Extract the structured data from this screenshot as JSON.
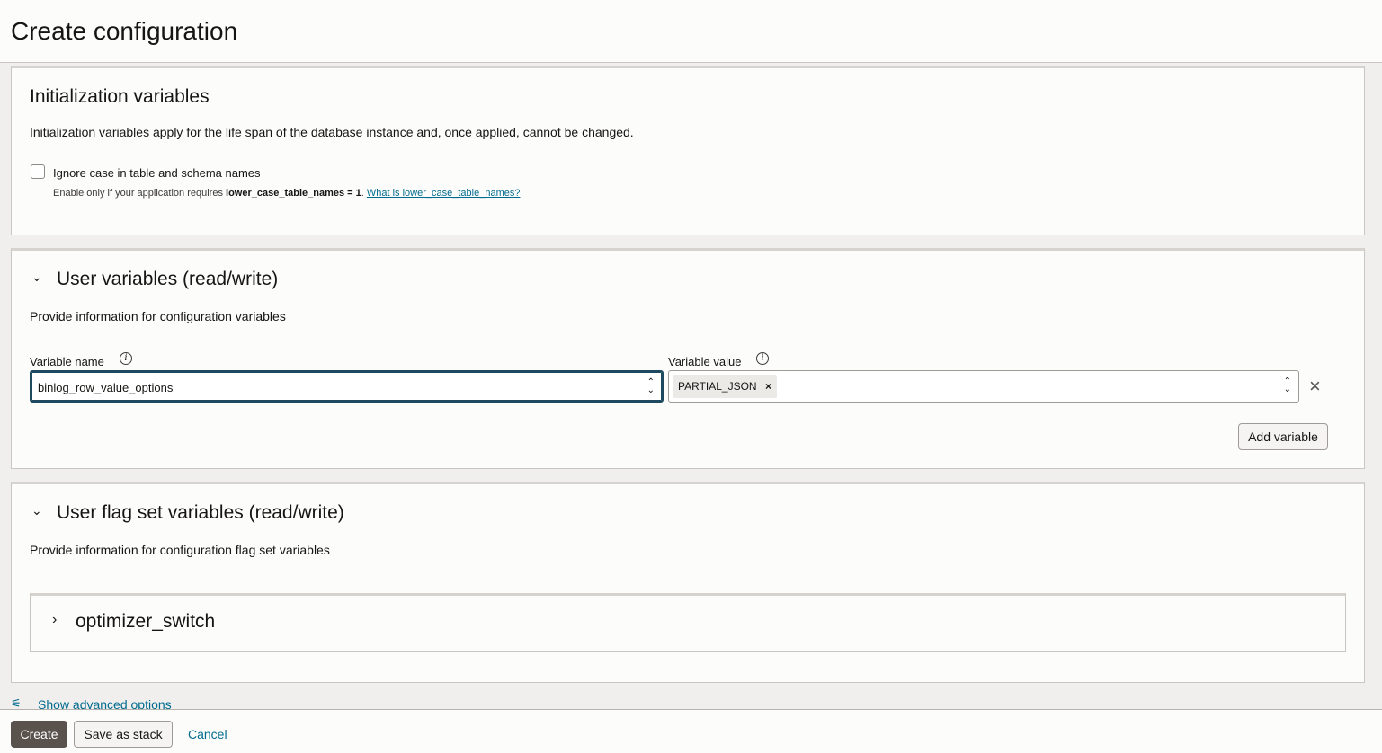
{
  "page": {
    "title": "Create configuration"
  },
  "init": {
    "title": "Initialization variables",
    "description": "Initialization variables apply for the life span of the database instance and, once applied, cannot be changed.",
    "checkbox_label": "Ignore case in table and schema names",
    "checked": false,
    "help_prefix": "Enable only if your application requires ",
    "help_bold": "lower_case_table_names = 1",
    "help_suffix": ". ",
    "help_link": "What is lower_case_table_names?"
  },
  "user_vars": {
    "title": "User variables (read/write)",
    "description": "Provide information for configuration variables",
    "name_label": "Variable name",
    "value_label": "Variable value",
    "name_value": "binlog_row_value_options",
    "value_chip": "PARTIAL_JSON",
    "add_button": "Add variable"
  },
  "flag_vars": {
    "title": "User flag set variables (read/write)",
    "description": "Provide information for configuration flag set variables",
    "item": "optimizer_switch"
  },
  "advanced_link": "Show advanced options",
  "footer": {
    "create": "Create",
    "save_stack": "Save as stack",
    "cancel": "Cancel"
  }
}
